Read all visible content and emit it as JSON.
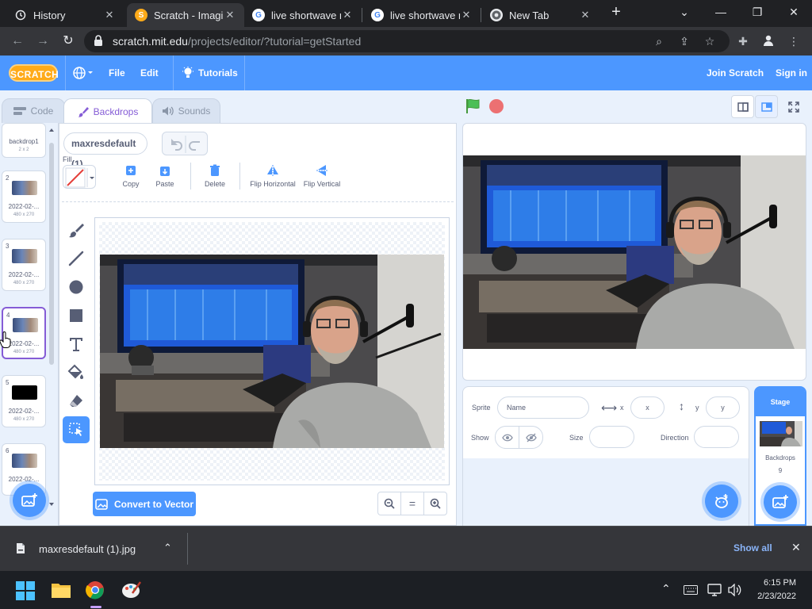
{
  "browser": {
    "tabs": [
      {
        "title": "History",
        "icon": "history-icon"
      },
      {
        "title": "Scratch - Imagine",
        "icon": "scratch-favicon"
      },
      {
        "title": "live shortwave r",
        "icon": "google-favicon"
      },
      {
        "title": "live shortwave r",
        "icon": "google-favicon"
      },
      {
        "title": "New Tab",
        "icon": "chrome-favicon"
      }
    ],
    "url_host": "scratch.mit.edu",
    "url_path": "/projects/editor/?tutorial=getStarted"
  },
  "menubar": {
    "logo": "SCRATCH",
    "file": "File",
    "edit": "Edit",
    "tutorials": "Tutorials",
    "join": "Join Scratch",
    "signin": "Sign in"
  },
  "editor_tabs": {
    "code": "Code",
    "backdrops": "Backdrops",
    "sounds": "Sounds"
  },
  "backdrops": [
    {
      "num": "",
      "name": "backdrop1",
      "size": "2 x 2",
      "thumb": "none"
    },
    {
      "num": "2",
      "name": "2022-02-...",
      "size": "480 x 270",
      "thumb": "photo"
    },
    {
      "num": "3",
      "name": "2022-02-...",
      "size": "480 x 270",
      "thumb": "photo"
    },
    {
      "num": "4",
      "name": "2022-02-...",
      "size": "480 x 270",
      "thumb": "photo"
    },
    {
      "num": "5",
      "name": "2022-02-...",
      "size": "480 x 270",
      "thumb": "black"
    },
    {
      "num": "6",
      "name": "2022-02-...",
      "size": "",
      "thumb": "photo"
    }
  ],
  "paint": {
    "costume_name": "maxresdefault (1)",
    "fill_label": "Fill",
    "copy": "Copy",
    "paste": "Paste",
    "delete": "Delete",
    "flip_h": "Flip Horizontal",
    "flip_v": "Flip Vertical",
    "convert": "Convert to Vector",
    "zoom_reset": "="
  },
  "sprite_info": {
    "sprite_label": "Sprite",
    "name_placeholder": "Name",
    "x_label": "x",
    "x_placeholder": "x",
    "y_label": "y",
    "y_placeholder": "y",
    "show_label": "Show",
    "size_label": "Size",
    "direction_label": "Direction"
  },
  "stage_panel": {
    "title": "Stage",
    "backdrops_label": "Backdrops",
    "backdrops_count": "9"
  },
  "download": {
    "filename": "maxresdefault (1).jpg",
    "show_all": "Show all"
  },
  "taskbar": {
    "time": "6:15 PM",
    "date": "2/23/2022"
  },
  "colors": {
    "scratch_blue": "#4c97ff",
    "scratch_purple": "#855cd6",
    "scratch_orange": "#ffab19"
  }
}
